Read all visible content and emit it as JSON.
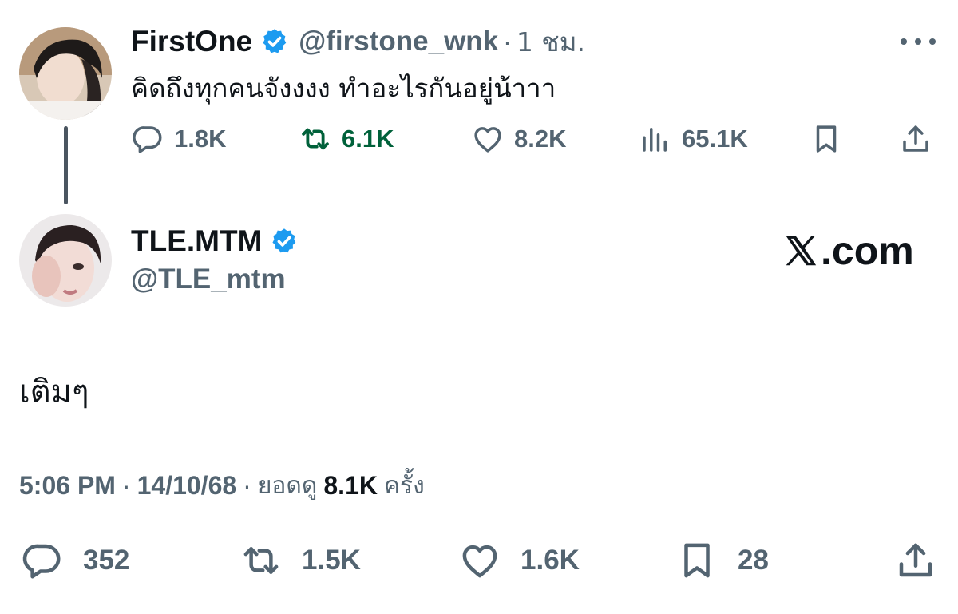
{
  "parent_tweet": {
    "display_name": "FirstOne",
    "handle": "@firstone_wnk",
    "separator": "·",
    "time": "1 ชม.",
    "text": "คิดถึงทุกคนจังงงง ทำอะไรกันอยู่น้าาา",
    "metrics": {
      "replies": "1.8K",
      "reposts": "6.1K",
      "likes": "8.2K",
      "views": "65.1K"
    },
    "icons": [
      "reply-icon",
      "repost-icon",
      "like-icon",
      "views-icon",
      "bookmark-icon",
      "share-icon",
      "more-icon",
      "verified-icon"
    ],
    "repost_color": "#00613a"
  },
  "reply_tweet": {
    "display_name": "TLE.MTM",
    "handle": "@TLE_mtm",
    "text": "เติมๆ",
    "meta": {
      "time": "5:06 PM",
      "separator": "·",
      "date": "14/10/68",
      "views_label": "ยอดดู",
      "views": "8.1K",
      "views_suffix": "ครั้ง"
    },
    "metrics": {
      "replies": "352",
      "reposts": "1.5K",
      "likes": "1.6K",
      "bookmarks": "28"
    }
  },
  "brand": {
    "text": ".com",
    "icon": "x-logo-icon"
  },
  "colors": {
    "text_primary": "#0f1419",
    "text_secondary": "#536471",
    "verified_blue": "#1d9bf0",
    "repost_green": "#00613a"
  }
}
